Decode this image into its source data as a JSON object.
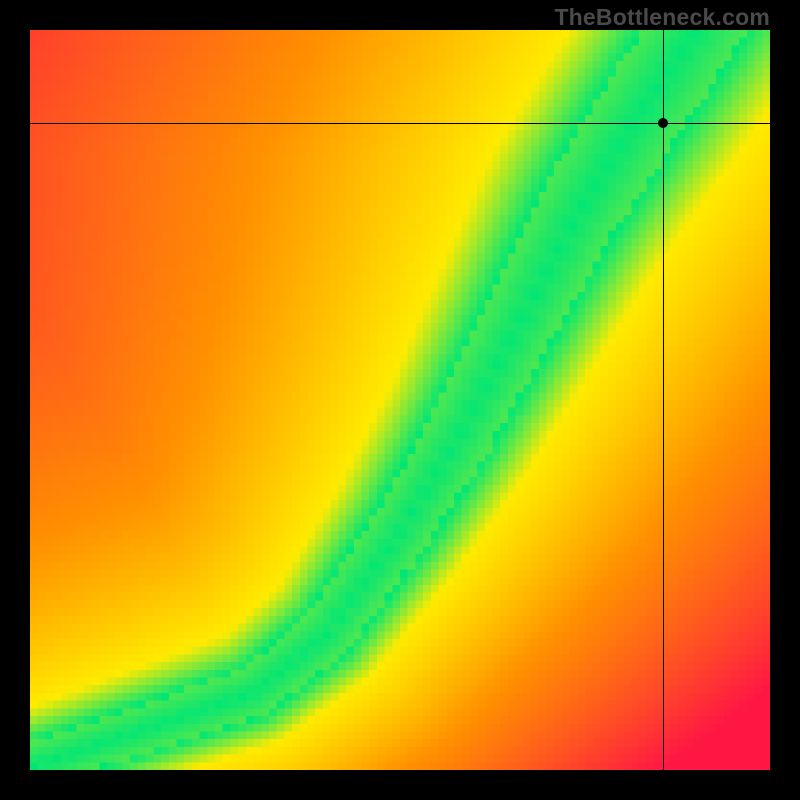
{
  "watermark": "TheBottleneck.com",
  "chart_data": {
    "type": "heatmap",
    "title": "",
    "xlabel": "",
    "ylabel": "",
    "xlim": [
      0,
      1
    ],
    "ylim": [
      0,
      1
    ],
    "marker": {
      "x": 0.855,
      "y": 0.875
    },
    "crosshair": {
      "x": 0.855,
      "y": 0.875
    },
    "colorscale_note": "red (far) → orange → yellow → green (optimal) diagonal band; pixelated",
    "grid_resolution": 96,
    "optimal_band": {
      "description": "Green optimal band runs from bottom-left toward top-right with steep slope above ~y=0.15",
      "control_points_norm": [
        {
          "x": 0.0,
          "y": 0.0
        },
        {
          "x": 0.18,
          "y": 0.06
        },
        {
          "x": 0.3,
          "y": 0.1
        },
        {
          "x": 0.4,
          "y": 0.18
        },
        {
          "x": 0.5,
          "y": 0.32
        },
        {
          "x": 0.58,
          "y": 0.45
        },
        {
          "x": 0.66,
          "y": 0.6
        },
        {
          "x": 0.74,
          "y": 0.75
        },
        {
          "x": 0.82,
          "y": 0.88
        },
        {
          "x": 0.9,
          "y": 1.0
        }
      ]
    },
    "colors": {
      "far": "#ff1744",
      "mid": "#ff9100",
      "near": "#ffeb00",
      "optimal": "#00e676"
    }
  }
}
